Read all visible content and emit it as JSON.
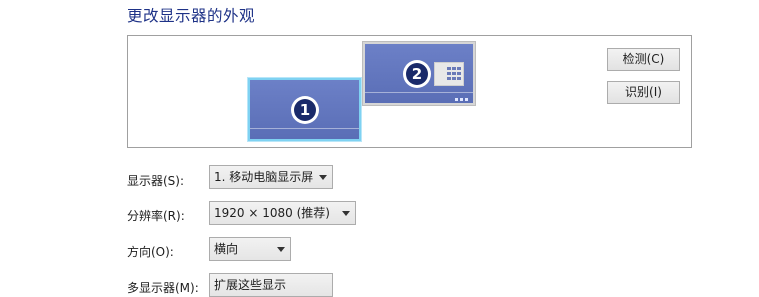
{
  "page": {
    "title": "更改显示器的外观"
  },
  "preview": {
    "monitors": [
      {
        "number": "1"
      },
      {
        "number": "2"
      }
    ],
    "buttons": {
      "detect": "检测(C)",
      "identify": "识别(I)"
    }
  },
  "settings": {
    "display": {
      "label": "显示器(S):",
      "value": "1. 移动电脑显示屏"
    },
    "resolution": {
      "label": "分辨率(R):",
      "value": "1920 × 1080 (推荐)"
    },
    "orientation": {
      "label": "方向(O):",
      "value": "横向"
    },
    "multiple": {
      "label": "多显示器(M):",
      "value": "扩展这些显示"
    }
  },
  "colors": {
    "title": "#1e3287",
    "monitor_fill": "#5a6eb6",
    "selected_border": "#7fd2f2"
  }
}
